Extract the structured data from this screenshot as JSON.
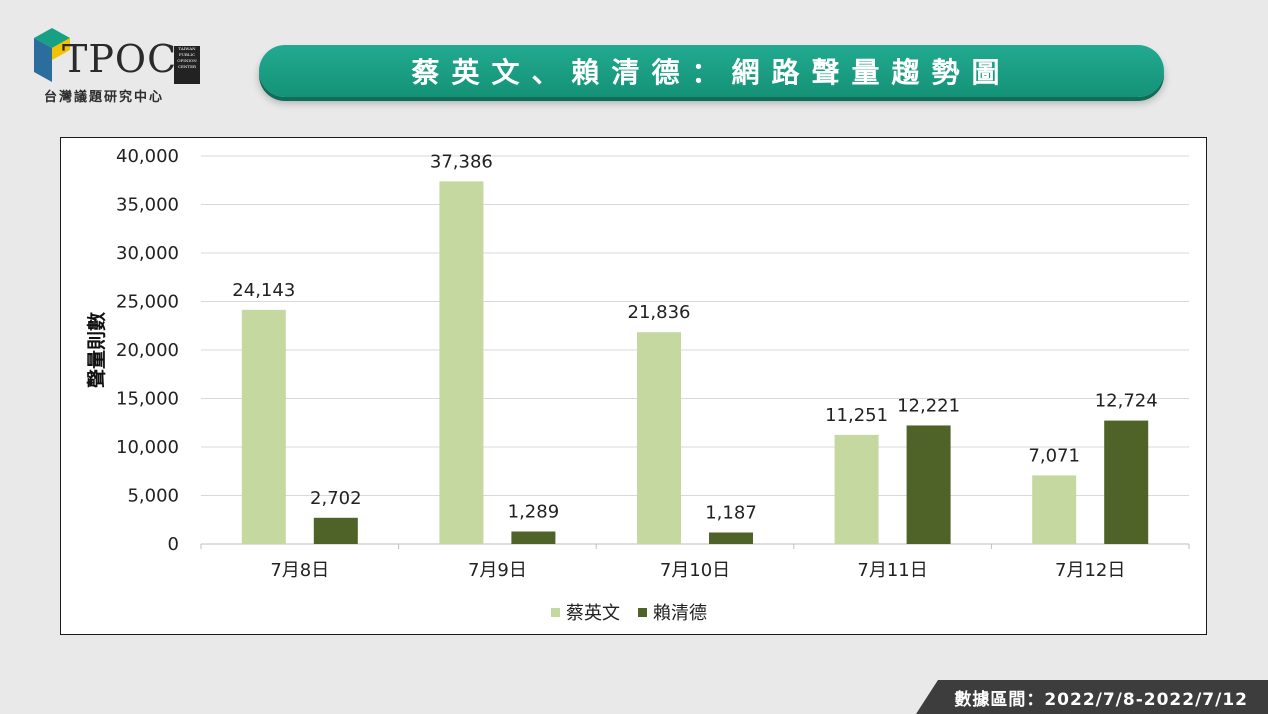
{
  "header": {
    "logo_text": "TPOC",
    "logo_small_lines": [
      "TAIWAN",
      "PUBLIC",
      "OPINION",
      "CENTER"
    ],
    "logo_subtitle": "台灣議題研究中心",
    "title": "蔡英文、賴清德：網路聲量趨勢圖"
  },
  "footer": {
    "text": "數據區間：2022/7/8-2022/7/12"
  },
  "colors": {
    "series1": "#c5d8a0",
    "series2": "#4f6228",
    "banner": "#1a9e83"
  },
  "chart_data": {
    "type": "bar",
    "title": "",
    "xlabel": "",
    "ylabel": "聲量則數",
    "ylim": [
      0,
      40000
    ],
    "yticks": [
      0,
      5000,
      10000,
      15000,
      20000,
      25000,
      30000,
      35000,
      40000
    ],
    "ytick_labels": [
      "0",
      "5,000",
      "10,000",
      "15,000",
      "20,000",
      "25,000",
      "30,000",
      "35,000",
      "40,000"
    ],
    "grid": true,
    "legend": "bottom",
    "categories": [
      "7月8日",
      "7月9日",
      "7月10日",
      "7月11日",
      "7月12日"
    ],
    "series": [
      {
        "name": "蔡英文",
        "values": [
          24143,
          37386,
          21836,
          11251,
          7071
        ],
        "labels": [
          "24,143",
          "37,386",
          "21,836",
          "11,251",
          "7,071"
        ]
      },
      {
        "name": "賴清德",
        "values": [
          2702,
          1289,
          1187,
          12221,
          12724
        ],
        "labels": [
          "2,702",
          "1,289",
          "1,187",
          "12,221",
          "12,724"
        ]
      }
    ]
  }
}
